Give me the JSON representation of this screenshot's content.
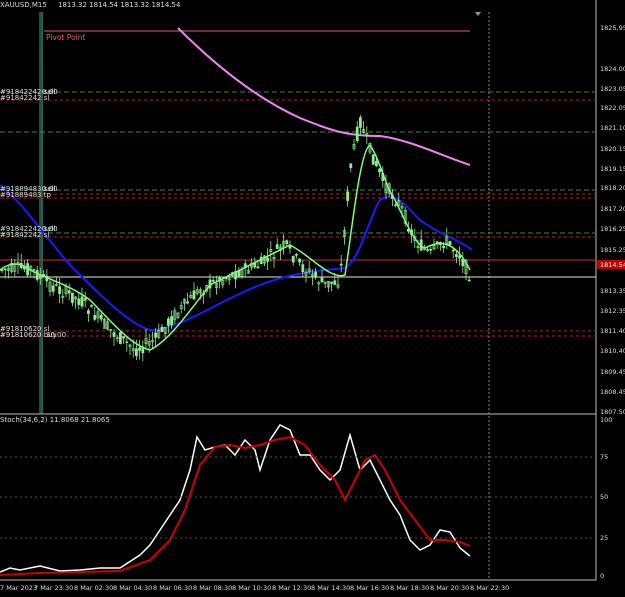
{
  "header": {
    "symbol": "XAUUSD,M15",
    "ohlc": "1813.32 1814.54 1813.32 1814.54"
  },
  "labels": {
    "pivot_point": "Pivot Point",
    "order_labels": [
      "#91842242 sell",
      "#91842242 sl",
      "#91889483 sell",
      "#91889483 tp",
      "#91842242 sell",
      "#91842242 sl",
      "#91810620 sl",
      "#91810620 buy"
    ],
    "order_values": [
      "0.00",
      "0.00",
      "0.00",
      "30.00"
    ]
  },
  "price_axis": {
    "ticks": [
      "1825.95",
      "1824.00",
      "1823.05",
      "1822.05",
      "1821.10",
      "1820.15",
      "1819.15",
      "1818.20",
      "1817.20",
      "1816.25",
      "1815.25",
      "1813.35",
      "1812.35",
      "1811.40",
      "1810.40",
      "1809.45",
      "1808.45",
      "1807.50"
    ],
    "current_price": "1814.54",
    "current_bg": "#c00000"
  },
  "time_axis": {
    "ticks": [
      "7 Mar 2023",
      "7 Mar 23:30",
      "8 Mar 02:30",
      "8 Mar 04:30",
      "8 Mar 06:30",
      "8 Mar 08:30",
      "8 Mar 10:30",
      "8 Mar 12:30",
      "8 Mar 14:30",
      "8 Mar 16:30",
      "8 Mar 18:30",
      "8 Mar 20:30",
      "8 Mar 22:30"
    ]
  },
  "stoch": {
    "title": "Stoch(34,6,2) 11.8068 21.8065",
    "ticks": [
      "100",
      "75",
      "50",
      "25",
      "0"
    ]
  },
  "colors": {
    "candle": "#90ee90",
    "ma_fast": "#7fff7f",
    "ma_slow": "#1010ff",
    "ma_long": "#ee82ee",
    "stoch_main": "#ffffff",
    "stoch_signal": "#cc0000",
    "pivot": "#e06060",
    "grid": "#555555"
  }
}
